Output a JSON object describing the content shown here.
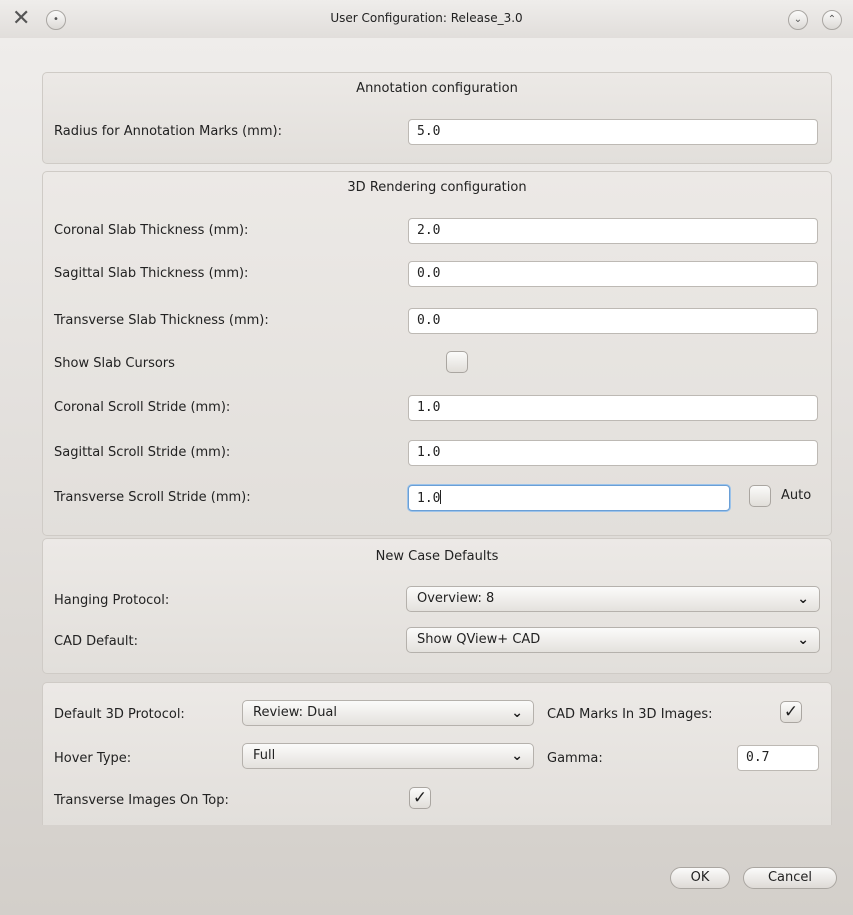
{
  "window": {
    "title": "User Configuration: Release_3.0",
    "app_icon": "tools-icon",
    "menu_icon": "window-menu-icon",
    "minimize_icon": "chevron-down-icon",
    "maximize_icon": "chevron-up-icon"
  },
  "annotation": {
    "title": "Annotation configuration",
    "radius_label": "Radius for Annotation Marks (mm):",
    "radius_value": "5.0"
  },
  "rendering": {
    "title": "3D Rendering configuration",
    "coronal_slab_label": "Coronal Slab Thickness (mm):",
    "coronal_slab_value": "2.0",
    "sagittal_slab_label": "Sagittal Slab Thickness (mm):",
    "sagittal_slab_value": "0.0",
    "transverse_slab_label": "Transverse Slab Thickness (mm):",
    "transverse_slab_value": "0.0",
    "show_slab_cursors_label": "Show Slab Cursors",
    "show_slab_cursors_checked": false,
    "coronal_stride_label": "Coronal Scroll Stride (mm):",
    "coronal_stride_value": "1.0",
    "sagittal_stride_label": "Sagittal Scroll Stride (mm):",
    "sagittal_stride_value": "1.0",
    "transverse_stride_label": "Transverse Scroll Stride (mm):",
    "transverse_stride_value": "1.0",
    "auto_label": "Auto",
    "auto_checked": false
  },
  "new_case": {
    "title": "New Case Defaults",
    "hanging_label": "Hanging Protocol:",
    "hanging_value": "Overview: 8",
    "cad_label": "CAD Default:",
    "cad_value": "Show QView+ CAD"
  },
  "view3d": {
    "protocol_label": "Default 3D Protocol:",
    "protocol_value": "Review: Dual",
    "cad_marks_label": "CAD Marks In 3D Images:",
    "cad_marks_checked": true,
    "hover_label": "Hover Type:",
    "hover_value": "Full",
    "gamma_label": "Gamma:",
    "gamma_value": "0.7",
    "transverse_top_label": "Transverse Images On Top:",
    "transverse_top_checked": true
  },
  "buttons": {
    "ok": "OK",
    "cancel": "Cancel"
  },
  "glyphs": {
    "check": "✓",
    "dropdown": "⌄"
  }
}
